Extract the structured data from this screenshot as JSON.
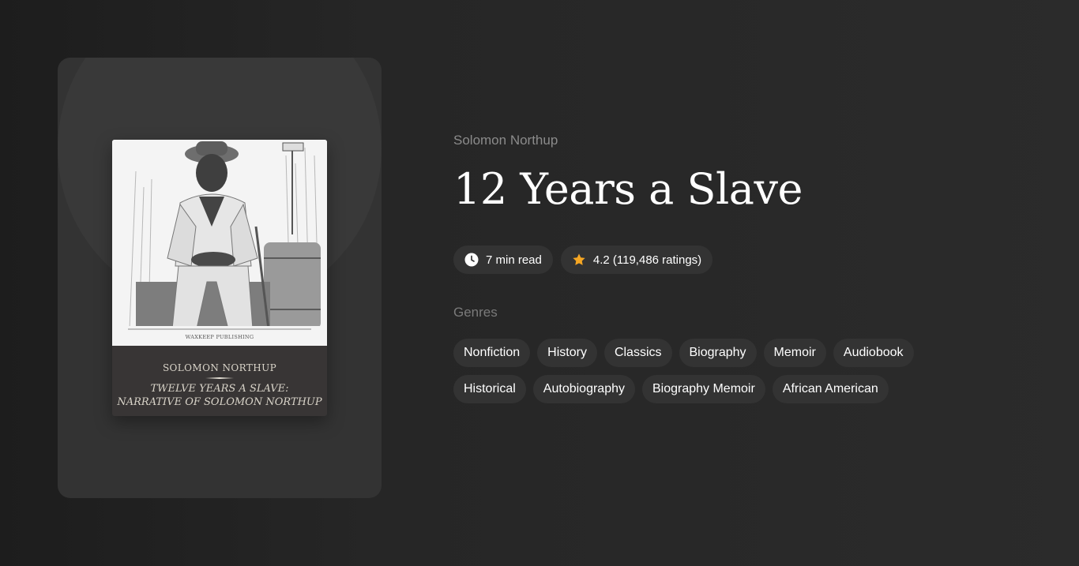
{
  "book": {
    "author": "Solomon Northup",
    "title": "12 Years a Slave",
    "read_time": "7 min read",
    "rating": "4.2 (119,486 ratings)",
    "accent_color": "#f5a623"
  },
  "cover": {
    "publisher": "WAXKEEP PUBLISHING",
    "author_line": "SOLOMON NORTHUP",
    "subtitle_line1": "TWELVE YEARS A SLAVE:",
    "subtitle_line2": "NARRATIVE OF SOLOMON NORTHUP"
  },
  "genres": {
    "label": "Genres",
    "items": [
      "Nonfiction",
      "History",
      "Classics",
      "Biography",
      "Memoir",
      "Audiobook",
      "Historical",
      "Autobiography",
      "Biography Memoir",
      "African American"
    ]
  },
  "icons": {
    "time": "clock-icon",
    "rating": "star-icon"
  }
}
